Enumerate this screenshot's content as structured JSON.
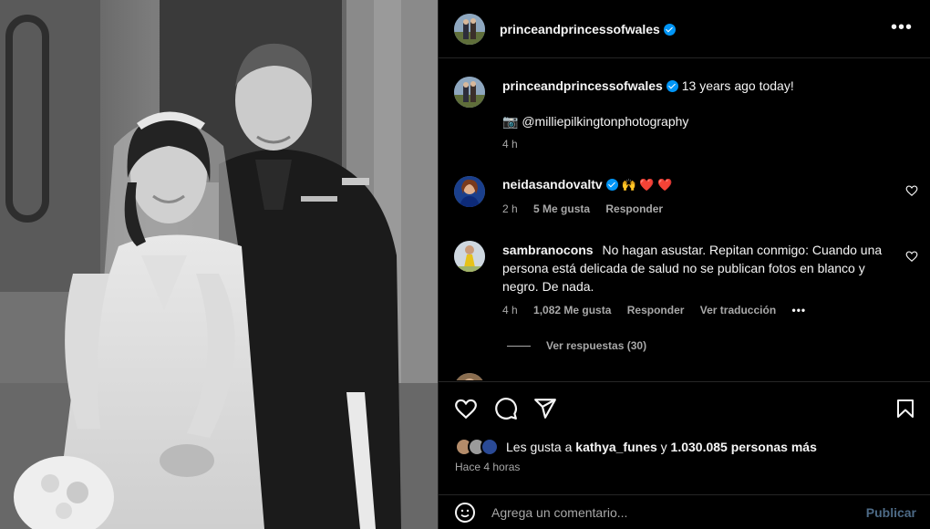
{
  "post": {
    "username": "princeandprincessofwales",
    "caption_text": "13 years ago today!",
    "photo_credit": "📷 @milliepilkingtonphotography",
    "caption_time": "4 h",
    "likes_prefix": "Les gusta a",
    "likes_user": "kathya_funes",
    "likes_joiner": "y",
    "likes_count": "1.030.085 personas más",
    "posted_ago": "Hace 4 horas"
  },
  "comments": [
    {
      "username": "neidasandovaltv",
      "text": "🙌 ❤️ ❤️",
      "time": "2 h",
      "likes": "5 Me gusta",
      "reply": "Responder"
    },
    {
      "username": "sambranocons",
      "text": "No hagan asustar. Repitan conmigo: Cuando una persona está delicada de salud no se publican fotos en blanco y negro. De nada.",
      "time": "4 h",
      "likes": "1,082 Me gusta",
      "reply": "Responder",
      "translate": "Ver traducción",
      "view_replies": "Ver respuestas (30)"
    }
  ],
  "add_comment": {
    "placeholder": "Agrega un comentario...",
    "publish": "Publicar"
  },
  "colors": {
    "background": "#000000",
    "text": "#f5f5f5",
    "secondary": "#a8a8a8",
    "verified": "#0095f6",
    "publish_disabled": "#4d6a86",
    "heart": "#ed4956"
  },
  "icons": [
    "more-options-icon",
    "verified-icon",
    "heart-icon",
    "comment-icon",
    "share-icon",
    "bookmark-icon",
    "emoji-icon"
  ]
}
